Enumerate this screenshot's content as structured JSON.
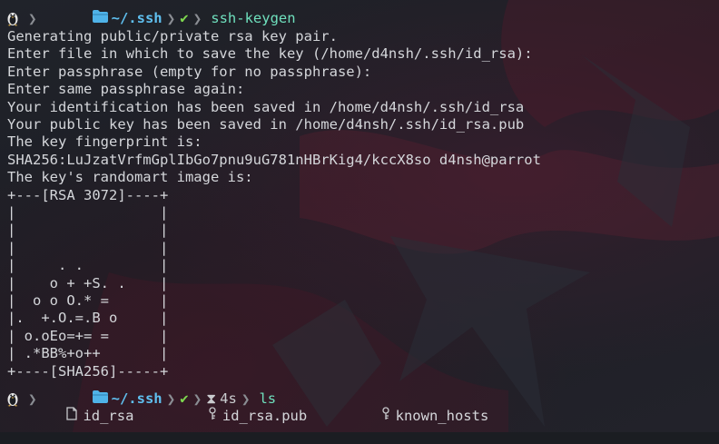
{
  "prompt1": {
    "path": "~/.ssh",
    "status_icon": "checkmark-icon",
    "command": "ssh-keygen"
  },
  "output_lines": [
    "Generating public/private rsa key pair.",
    "Enter file in which to save the key (/home/d4nsh/.ssh/id_rsa):",
    "Enter passphrase (empty for no passphrase):",
    "Enter same passphrase again:",
    "Your identification has been saved in /home/d4nsh/.ssh/id_rsa",
    "Your public key has been saved in /home/d4nsh/.ssh/id_rsa.pub",
    "The key fingerprint is:",
    "SHA256:LuJzatVrfmGplIbGo7pnu9uG781nHBrKig4/kccX8so d4nsh@parrot",
    "The key's randomart image is:",
    "+---[RSA 3072]----+",
    "|                 |",
    "|                 |",
    "|                 |",
    "|     . .         |",
    "|    o + +S. .    |",
    "|  o o O.* =      |",
    "|.  +.O.=.B o     |",
    "| o.oEo=+= =      |",
    "| .*BB%+o++       |",
    "+----[SHA256]-----+"
  ],
  "prompt2": {
    "path": "~/.ssh",
    "status_icon": "checkmark-icon",
    "duration": "4s",
    "command": "ls"
  },
  "files": [
    {
      "name": "id_rsa",
      "icon": "file-icon"
    },
    {
      "name": "id_rsa.pub",
      "icon": "key-icon"
    },
    {
      "name": "known_hosts",
      "icon": "key-icon"
    }
  ],
  "colors": {
    "path": "#5fc0f0",
    "ok": "#7ed84f",
    "command": "#6fe0bd",
    "text": "#d4d6da"
  }
}
